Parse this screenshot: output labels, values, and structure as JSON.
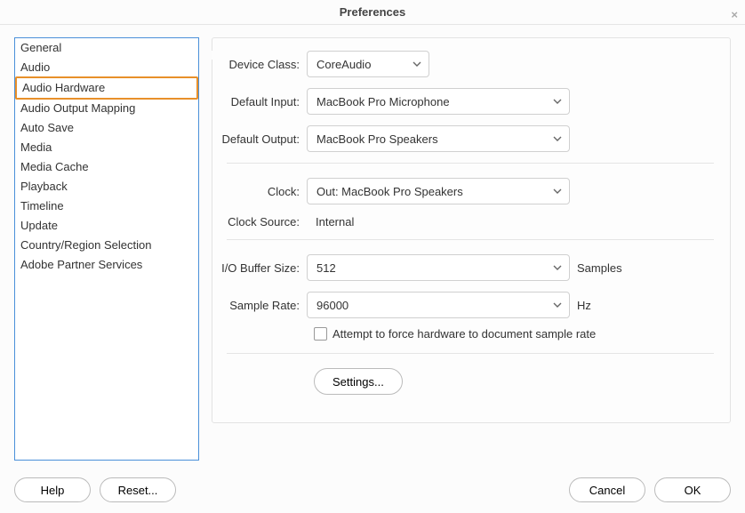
{
  "window": {
    "title": "Preferences"
  },
  "sidebar": {
    "items": [
      {
        "label": "General"
      },
      {
        "label": "Audio"
      },
      {
        "label": "Audio Hardware",
        "selected": true
      },
      {
        "label": "Audio Output Mapping"
      },
      {
        "label": "Auto Save"
      },
      {
        "label": "Media"
      },
      {
        "label": "Media Cache"
      },
      {
        "label": "Playback"
      },
      {
        "label": "Timeline"
      },
      {
        "label": "Update"
      },
      {
        "label": "Country/Region Selection"
      },
      {
        "label": "Adobe Partner Services"
      }
    ]
  },
  "panel": {
    "deviceClass": {
      "label": "Device Class:",
      "value": "CoreAudio"
    },
    "defaultInput": {
      "label": "Default Input:",
      "value": "MacBook Pro Microphone"
    },
    "defaultOutput": {
      "label": "Default Output:",
      "value": "MacBook Pro Speakers"
    },
    "clock": {
      "label": "Clock:",
      "value": "Out: MacBook Pro Speakers"
    },
    "clockSource": {
      "label": "Clock Source:",
      "value": "Internal"
    },
    "ioBuffer": {
      "label": "I/O Buffer Size:",
      "value": "512",
      "suffix": "Samples"
    },
    "sampleRate": {
      "label": "Sample Rate:",
      "value": "96000",
      "suffix": "Hz"
    },
    "forceHwCheckbox": {
      "label": "Attempt to force hardware to document sample rate",
      "checked": false
    },
    "settingsButton": "Settings..."
  },
  "footer": {
    "help": "Help",
    "reset": "Reset...",
    "cancel": "Cancel",
    "ok": "OK"
  }
}
